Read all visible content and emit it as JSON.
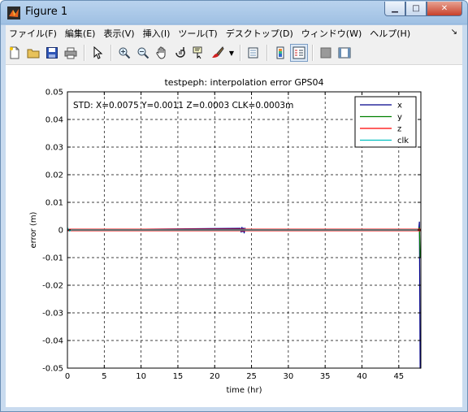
{
  "window": {
    "title": "Figure 1",
    "buttons": [
      "minimize",
      "maximize",
      "close"
    ]
  },
  "menubar": {
    "items": [
      "ファイル(F)",
      "編集(E)",
      "表示(V)",
      "挿入(I)",
      "ツール(T)",
      "デスクトップ(D)",
      "ウィンドウ(W)",
      "ヘルプ(H)"
    ]
  },
  "toolbar": {
    "icons": [
      "new-figure-icon",
      "open-icon",
      "save-icon",
      "print-icon",
      "edit-plot-icon",
      "zoom-in-icon",
      "zoom-out-icon",
      "pan-icon",
      "rotate-icon",
      "data-cursor-icon",
      "brush-icon",
      "link-icon",
      "colorbar-icon",
      "legend-icon",
      "hide-plot-tools-icon",
      "show-plot-tools-icon"
    ]
  },
  "chart_data": {
    "type": "line",
    "title": "testpeph: interpolation error GPS04",
    "xlabel": "time (hr)",
    "ylabel": "error (m)",
    "xlim": [
      0,
      48
    ],
    "ylim": [
      -0.05,
      0.05
    ],
    "xticks": [
      0,
      5,
      10,
      15,
      20,
      25,
      30,
      35,
      40,
      45
    ],
    "yticks": [
      0.05,
      0.04,
      0.03,
      0.02,
      0.01,
      0,
      -0.01,
      -0.02,
      -0.03,
      -0.04,
      -0.05
    ],
    "grid": true,
    "annotation": "STD: X=0.0075 Y=0.0011 Z=0.0003 CLK=0.0003m",
    "legend": {
      "placement": "top-right",
      "entries": [
        "x",
        "y",
        "z",
        "clk"
      ]
    },
    "series": [
      {
        "name": "x",
        "color": "#00008b",
        "x": [
          0,
          23.5,
          23.6,
          23.7,
          23.8,
          23.9,
          24.0,
          24.1,
          24.2,
          47.7,
          47.8,
          47.9,
          48
        ],
        "y": [
          0,
          0.0006,
          -0.0009,
          0.0011,
          -0.0007,
          0.0008,
          -0.0012,
          0.0005,
          0,
          0,
          0.003,
          -0.05,
          -0.05
        ]
      },
      {
        "name": "y",
        "color": "#008000",
        "x": [
          0,
          47.7,
          47.8,
          47.9,
          48
        ],
        "y": [
          0,
          0,
          0.001,
          -0.01,
          -0.01
        ]
      },
      {
        "name": "z",
        "color": "#ff0000",
        "x": [
          0,
          48
        ],
        "y": [
          0,
          0
        ]
      },
      {
        "name": "clk",
        "color": "#00bfbf",
        "x": [
          0,
          0.3,
          0.5,
          48
        ],
        "y": [
          0.0008,
          -0.0004,
          0,
          0
        ]
      }
    ]
  }
}
